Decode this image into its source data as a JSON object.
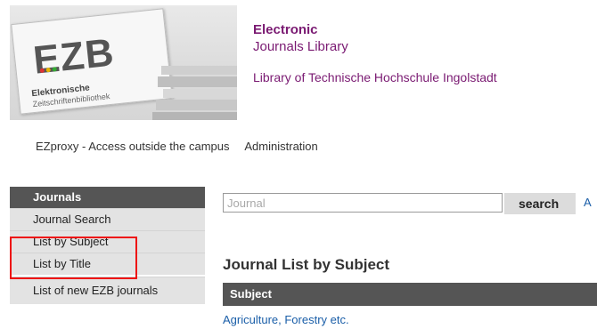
{
  "logo": {
    "mark": "EZB",
    "line1": "Elektronische",
    "line2": "Zeitschriftenbibliothek"
  },
  "header": {
    "title_bold": "Electronic",
    "title_rest": "Journals Library",
    "institution": "Library of Technische Hochschule Ingolstadt"
  },
  "toplinks": {
    "ezproxy": "EZproxy - Access outside the campus",
    "admin": "Administration"
  },
  "sidebar": {
    "heading": "Journals",
    "items": [
      {
        "label": "Journal Search"
      },
      {
        "label": "List by Subject"
      },
      {
        "label": "List by Title"
      },
      {
        "label": "List of new EZB journals"
      }
    ]
  },
  "search": {
    "placeholder": "Journal",
    "button": "search",
    "advanced": "A"
  },
  "main": {
    "title": "Journal List by Subject",
    "column_header": "Subject",
    "subjects": [
      "Agriculture, Forestry etc."
    ]
  },
  "colors": {
    "title": "#7a1a72",
    "sidebar_header": "#555555",
    "sidebar_item": "#e3e3e3",
    "link": "#1a5ea8",
    "highlight": "#ee1111"
  }
}
